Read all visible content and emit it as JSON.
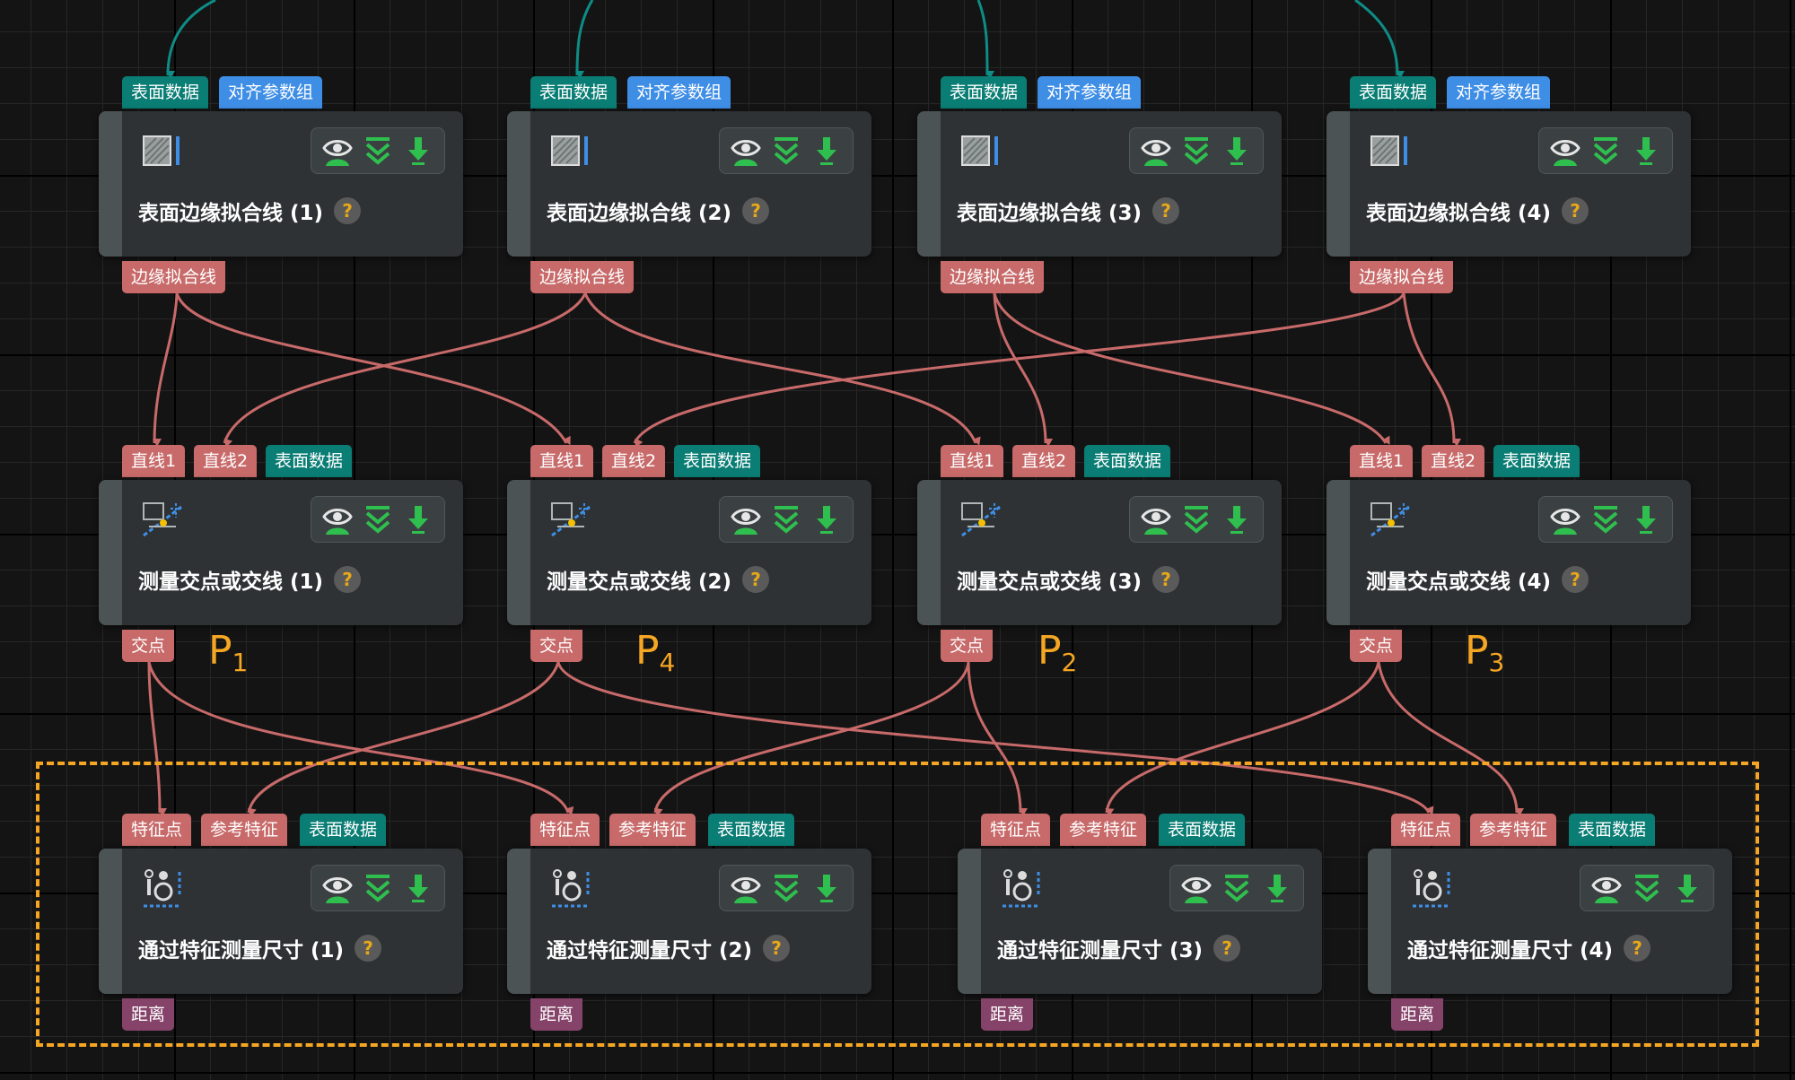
{
  "ports": {
    "surface_data": "表面数据",
    "align_params": "对齐参数组",
    "edge_fit_line": "边缘拟合线",
    "line1": "直线1",
    "line2": "直线2",
    "intersection": "交点",
    "feature_point": "特征点",
    "ref_feature": "参考特征",
    "distance": "距离"
  },
  "rows": [
    {
      "titles": [
        "表面边缘拟合线 (1)",
        "表面边缘拟合线 (2)",
        "表面边缘拟合线 (3)",
        "表面边缘拟合线 (4)"
      ]
    },
    {
      "titles": [
        "测量交点或交线 (1)",
        "测量交点或交线 (2)",
        "测量交点或交线 (3)",
        "测量交点或交线 (4)"
      ]
    },
    {
      "titles": [
        "通过特征测量尺寸 (1)",
        "通过特征测量尺寸 (2)",
        "通过特征测量尺寸 (3)",
        "通过特征测量尺寸 (4)"
      ]
    }
  ],
  "help_symbol": "?",
  "point_labels": [
    {
      "letter": "P",
      "index": "1"
    },
    {
      "letter": "P",
      "index": "4"
    },
    {
      "letter": "P",
      "index": "2"
    },
    {
      "letter": "P",
      "index": "3"
    }
  ],
  "toolbar_icons": [
    "eye-icon",
    "collapse-icon",
    "download-icon"
  ],
  "colors": {
    "teal_port": "#0a7d74",
    "blue_port": "#3f8ee6",
    "red_port": "#c86a6a",
    "purple_port": "#86436a",
    "wire_red": "#c86a6a",
    "wire_teal": "#0e8c86",
    "selection": "#f5a623",
    "node_bg": "#2e3234"
  }
}
